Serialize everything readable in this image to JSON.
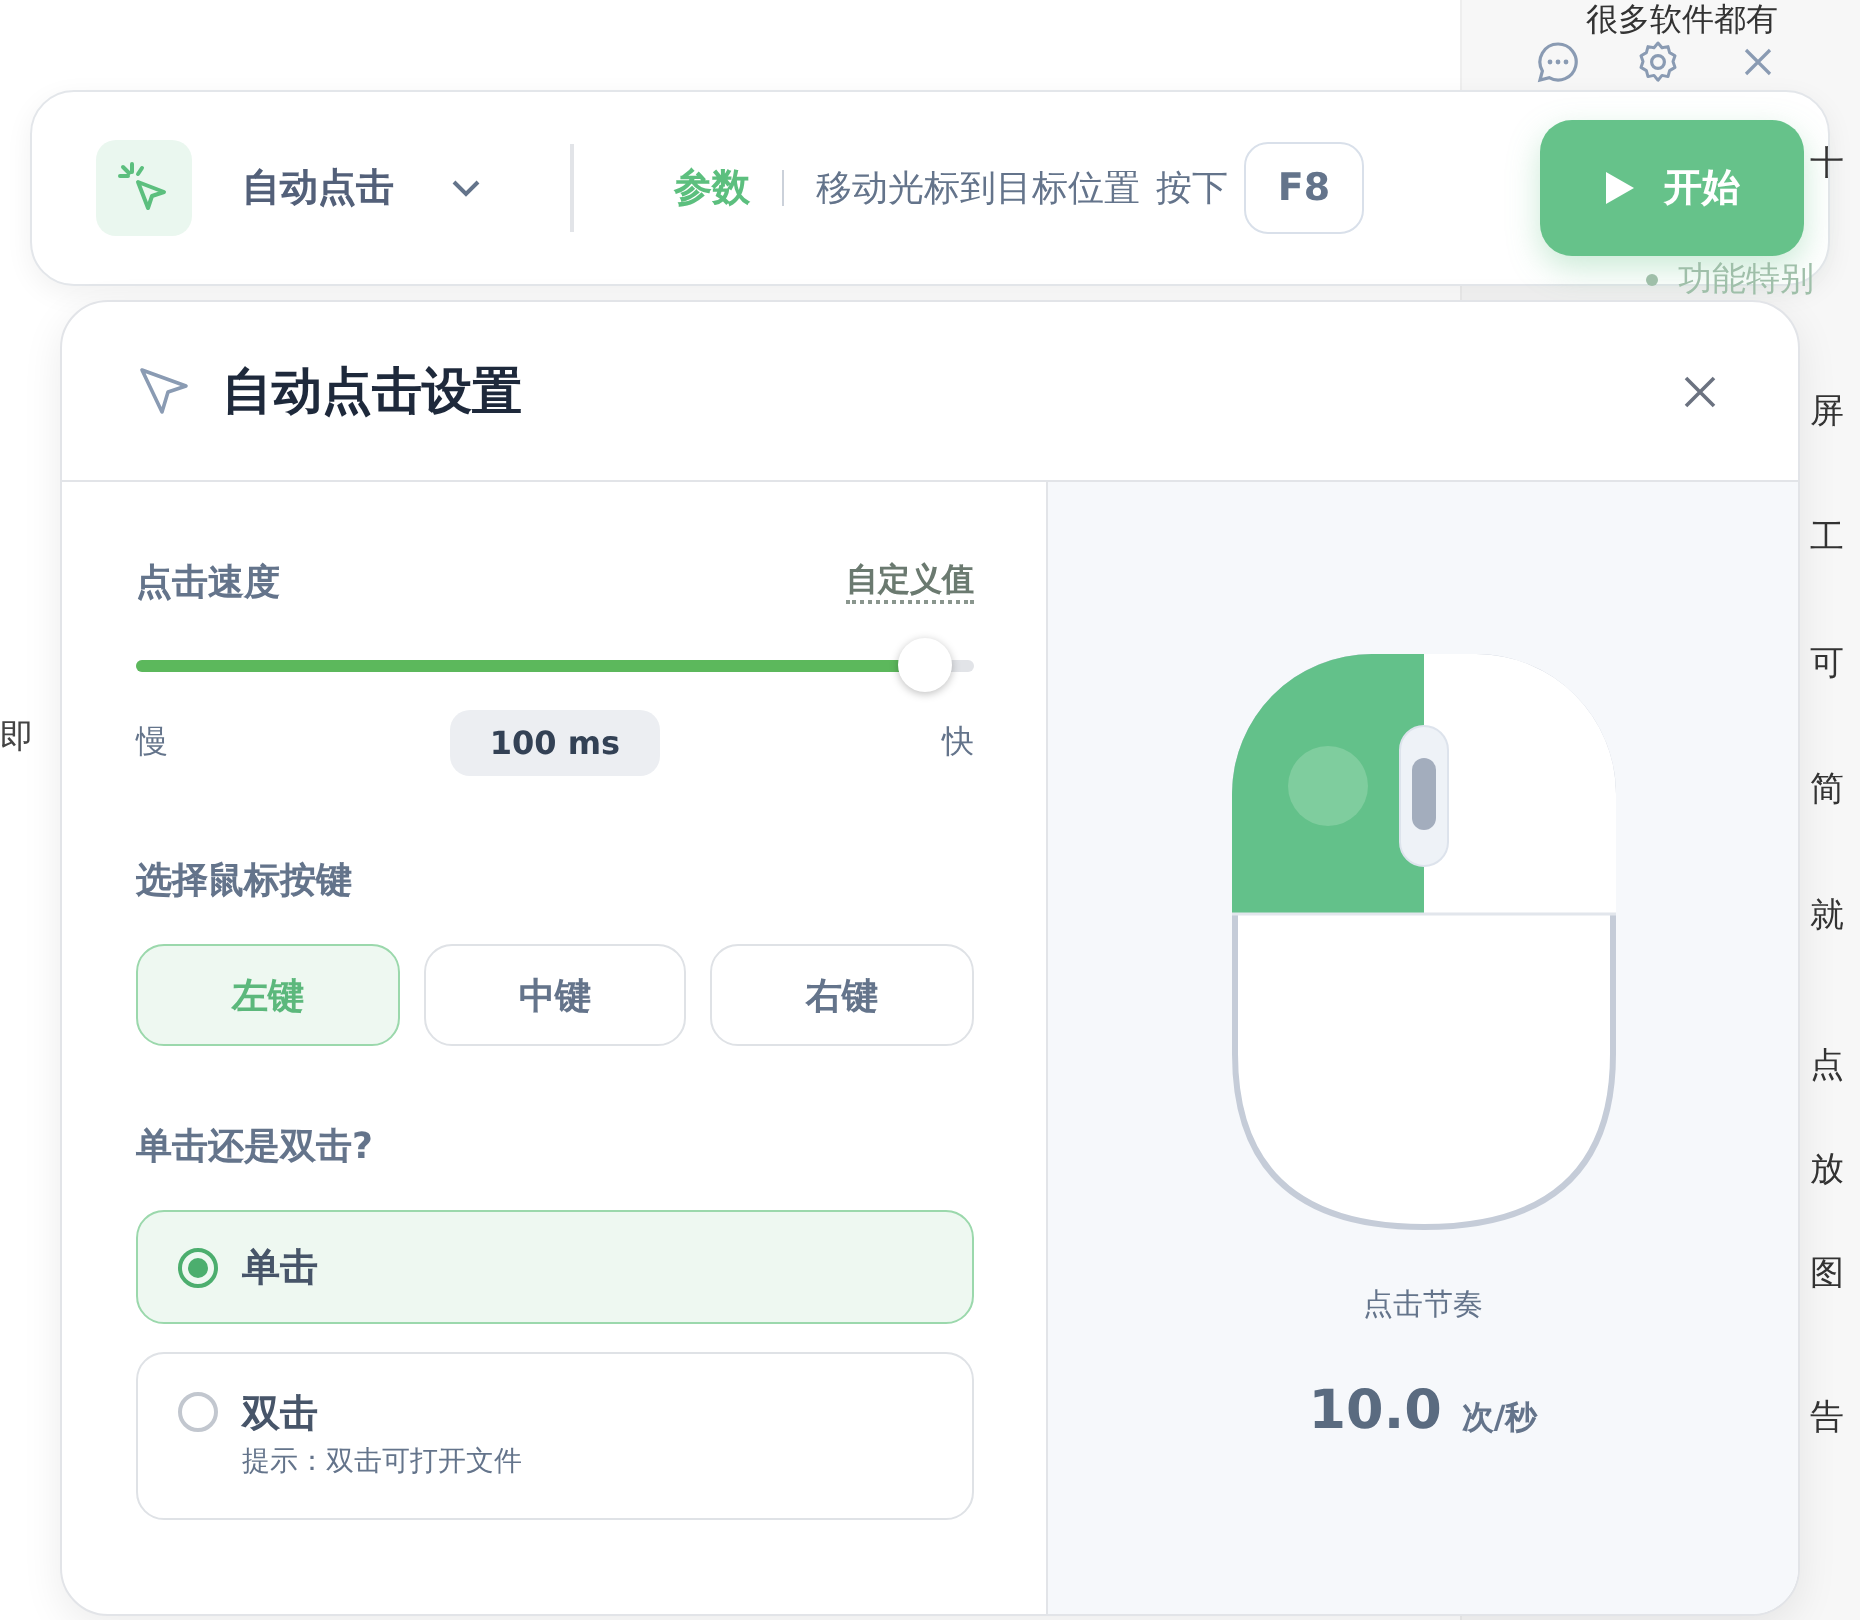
{
  "background": {
    "top_text": "很多软件都有",
    "left_text": "即",
    "side_lines": [
      {
        "text": "十",
        "faded": false
      },
      {
        "text": "功能特别",
        "faded": true
      },
      {
        "text": "屏",
        "faded": false
      },
      {
        "text": "工",
        "faded": false
      },
      {
        "text": "可",
        "faded": false
      },
      {
        "text": "简",
        "faded": false
      },
      {
        "text": "就",
        "faded": false
      },
      {
        "text": "点",
        "faded": false
      },
      {
        "text": "放",
        "faded": false
      },
      {
        "text": "图",
        "faded": false
      },
      {
        "text": "告",
        "faded": false
      }
    ]
  },
  "toolbar": {
    "mode": "自动点击",
    "tab": "参数",
    "hint": "移动光标到目标位置",
    "press": "按下",
    "hotkey": "F8",
    "start_button": "开始"
  },
  "dialog": {
    "title": "自动点击设置",
    "speed": {
      "label": "点击速度",
      "custom_link": "自定义值",
      "level": 0.94,
      "slow": "慢",
      "fast": "快",
      "value": "100 ms"
    },
    "button_label": "选择鼠标按键",
    "mouse_buttons": [
      {
        "label": "左键",
        "selected": true
      },
      {
        "label": "中键",
        "selected": false
      },
      {
        "label": "右键",
        "selected": false
      }
    ],
    "click_label": "单击还是双击?",
    "click_types": [
      {
        "label": "单击",
        "selected": true
      },
      {
        "label": "双击",
        "hint": "提示：双击可打开文件",
        "selected": false
      }
    ],
    "preview": {
      "caption": "点击节奏",
      "rate": "10.0",
      "unit": "次/秒"
    }
  }
}
